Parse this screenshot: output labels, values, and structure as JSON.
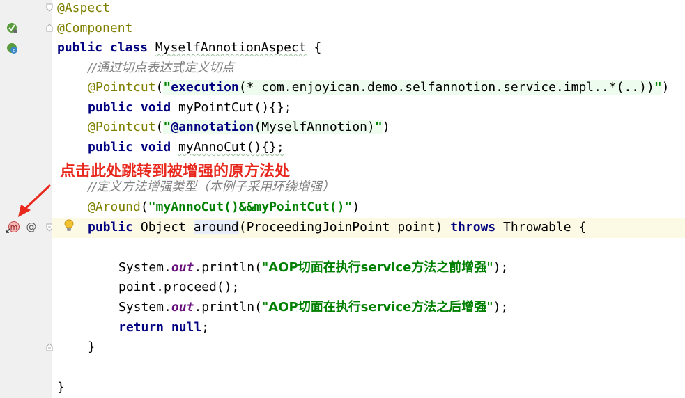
{
  "gutter_icons": {
    "aspect_marker": "spring-bean-icon",
    "component_marker": "spring-component-icon",
    "method_marker": "navigate-advised-method-icon",
    "at_marker": "annotation-at-icon",
    "hint": "lightbulb-icon"
  },
  "code": {
    "l1": "@Aspect",
    "l2": "@Component",
    "l3_kw": "public class ",
    "l3_name": "MyselfAnnotionAspect",
    "l3_end": " {",
    "l4": "//通过切点表达式定义切点",
    "l5_ann": "@Pointcut",
    "l5_open": "(",
    "l5_q1": "\"",
    "l5_exec": "execution",
    "l5_expr": "(* com.enjoyican.demo.selfannotion.service.impl..*(..))",
    "l5_q2": "\"",
    "l5_close": ")",
    "l6_kw": "public void ",
    "l6_rest": "myPointCut(){};",
    "l7_ann": "@Pointcut",
    "l7_open": "(",
    "l7_q1": "\"",
    "l7_at": "@annotation",
    "l7_expr": "(MyselfAnnotion)",
    "l7_q2": "\"",
    "l7_close": ")",
    "l8_kw": "public void ",
    "l8_rest": "myAnnoCut(){};",
    "l9": "//定义方法增强类型（本例子采用环绕增强）",
    "l10_ann": "@Around",
    "l10_open": "(",
    "l10_str": "\"myAnnoCut()&&myPointCut()\"",
    "l10_close": ")",
    "l11_kw": "public ",
    "l11_type": "Object ",
    "l11_name": "around",
    "l11_params": "(ProceedingJoinPoint point) ",
    "l11_throws": "throws",
    "l11_end": " Throwable {",
    "l13_sys": "System.",
    "l13_out": "out",
    "l13_call": ".println(",
    "l13_str": "\"AOP切面在执行service方法之前增强\"",
    "l13_end": ");",
    "l14": "point.proceed();",
    "l15_sys": "System.",
    "l15_out": "out",
    "l15_call": ".println(",
    "l15_str": "\"AOP切面在执行service方法之后增强\"",
    "l15_end": ");",
    "l16_kw": "return null",
    "l16_end": ";",
    "l17": "}",
    "l19": "}"
  },
  "annotation": {
    "text": "点击此处跳转到被增强的原方法处",
    "color": "#e8281d"
  }
}
